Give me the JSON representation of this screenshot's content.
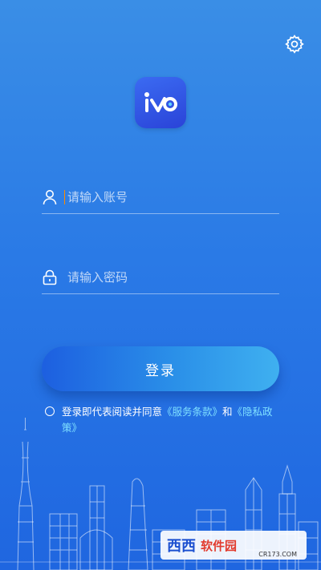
{
  "login": {
    "account_placeholder": "请输入账号",
    "password_placeholder": "请输入密码",
    "button_label": "登录"
  },
  "agreement": {
    "prefix": "登录即代表阅读并同意",
    "terms_link": "《服务条款》",
    "conjunction": "和",
    "privacy_link": "《隐私政策》"
  },
  "icons": {
    "settings": "gear-icon",
    "account": "user-icon",
    "password": "lock-icon"
  },
  "watermark": {
    "brand": "西西",
    "tag": "软件园",
    "domain": "CR173.COM"
  },
  "colors": {
    "background_top": "#3a8ee6",
    "background_bottom": "#1f66e0",
    "link": "#7fe0ff",
    "button_left": "#1d5fe0",
    "button_right": "#3fb0f0"
  }
}
